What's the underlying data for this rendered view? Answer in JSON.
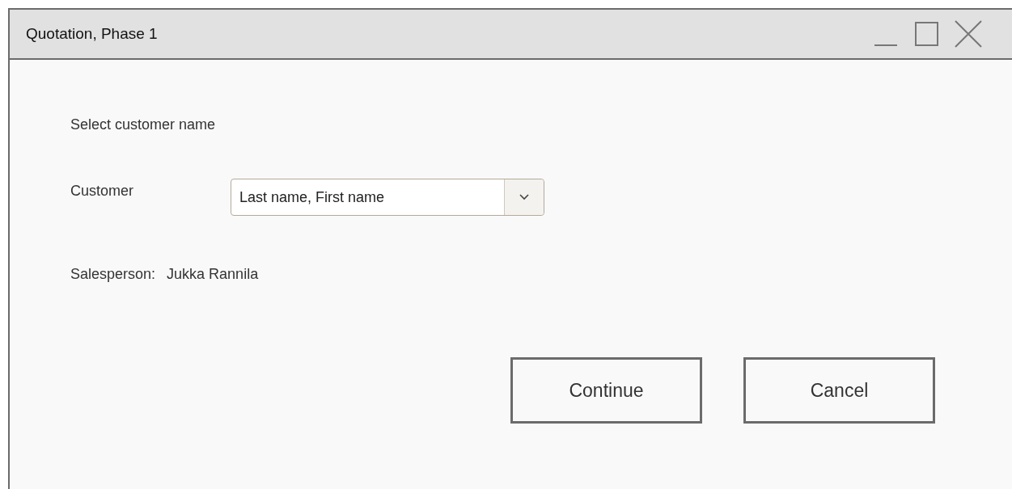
{
  "window": {
    "title": "Quotation, Phase 1"
  },
  "instruction": "Select customer name",
  "customer": {
    "label": "Customer",
    "value": "Last name, First name"
  },
  "salesperson": {
    "label": "Salesperson:",
    "value": "Jukka Rannila"
  },
  "buttons": [
    "Continue",
    "Cancel"
  ]
}
